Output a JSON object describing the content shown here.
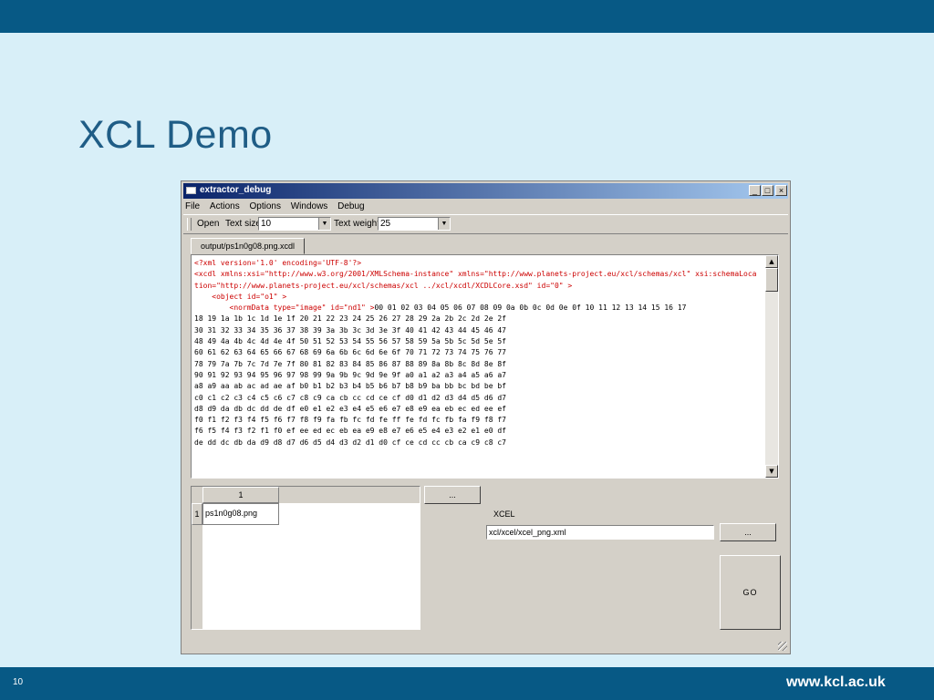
{
  "slide": {
    "title": "XCL Demo",
    "page_number": "10",
    "brand": "www.kcl.ac.uk"
  },
  "window": {
    "title": "extractor_debug",
    "controls": {
      "minimize": "_",
      "maximize": "□",
      "close": "×"
    }
  },
  "menu": [
    "File",
    "Actions",
    "Options",
    "Windows",
    "Debug"
  ],
  "toolbar": {
    "open_label": "Open",
    "text_size_label": "Text size",
    "text_size_value": "10",
    "text_weight_label": "Text weight",
    "text_weight_value": "25"
  },
  "editor": {
    "tab_label": "output/ps1n0g08.png.xcdl",
    "xml_line1": "<?xml version='1.0' encoding='UTF-8'?>",
    "xml_line2": "<xcdl xmlns:xsi=\"http://www.w3.org/2001/XMLSchema-instance\" xmlns=\"http://www.planets-project.eu/xcl/schemas/xcl\" xsi:schemaLocation=\"http://www.planets-project.eu/xcl/schemas/xcl ../xcl/xcdl/XCDLCore.xsd\" id=\"0\" >",
    "xml_line3": "    <object id=\"o1\" >",
    "xml_line4": "        <normData type=\"image\" id=\"nd1\" >",
    "hex_data": "00 01 02 03 04 05 06 07 08 09 0a 0b 0c 0d 0e 0f 10 11 12 13 14 15 16 17\n18 19 1a 1b 1c 1d 1e 1f 20 21 22 23 24 25 26 27 28 29 2a 2b 2c 2d 2e 2f\n30 31 32 33 34 35 36 37 38 39 3a 3b 3c 3d 3e 3f 40 41 42 43 44 45 46 47\n48 49 4a 4b 4c 4d 4e 4f 50 51 52 53 54 55 56 57 58 59 5a 5b 5c 5d 5e 5f\n60 61 62 63 64 65 66 67 68 69 6a 6b 6c 6d 6e 6f 70 71 72 73 74 75 76 77\n78 79 7a 7b 7c 7d 7e 7f 80 81 82 83 84 85 86 87 88 89 8a 8b 8c 8d 8e 8f\n90 91 92 93 94 95 96 97 98 99 9a 9b 9c 9d 9e 9f a0 a1 a2 a3 a4 a5 a6 a7\na8 a9 aa ab ac ad ae af b0 b1 b2 b3 b4 b5 b6 b7 b8 b9 ba bb bc bd be bf\nc0 c1 c2 c3 c4 c5 c6 c7 c8 c9 ca cb cc cd ce cf d0 d1 d2 d3 d4 d5 d6 d7\nd8 d9 da db dc dd de df e0 e1 e2 e3 e4 e5 e6 e7 e8 e9 ea eb ec ed ee ef\nf0 f1 f2 f3 f4 f5 f6 f7 f8 f9 fa fb fc fd fe ff fe fd fc fb fa f9 f8 f7\nf6 f5 f4 f3 f2 f1 f0 ef ee ed ec eb ea e9 e8 e7 e6 e5 e4 e3 e2 e1 e0 df\nde dd dc db da d9 d8 d7 d6 d5 d4 d3 d2 d1 d0 cf ce cd cc cb ca c9 c8 c7"
  },
  "file_table": {
    "column_header": "1",
    "row_number": "1",
    "cell_value": "ps1n0g08.png"
  },
  "controls": {
    "browse_label": "...",
    "xcel_label": "XCEL",
    "xcel_path": "xcl/xcel/xcel_png.xml",
    "xcel_browse_label": "...",
    "go_label": "GO"
  },
  "colors": {
    "band": "#075985",
    "background": "#d8eff8",
    "title_text": "#1f5d86",
    "xml_text": "#cc0000"
  }
}
